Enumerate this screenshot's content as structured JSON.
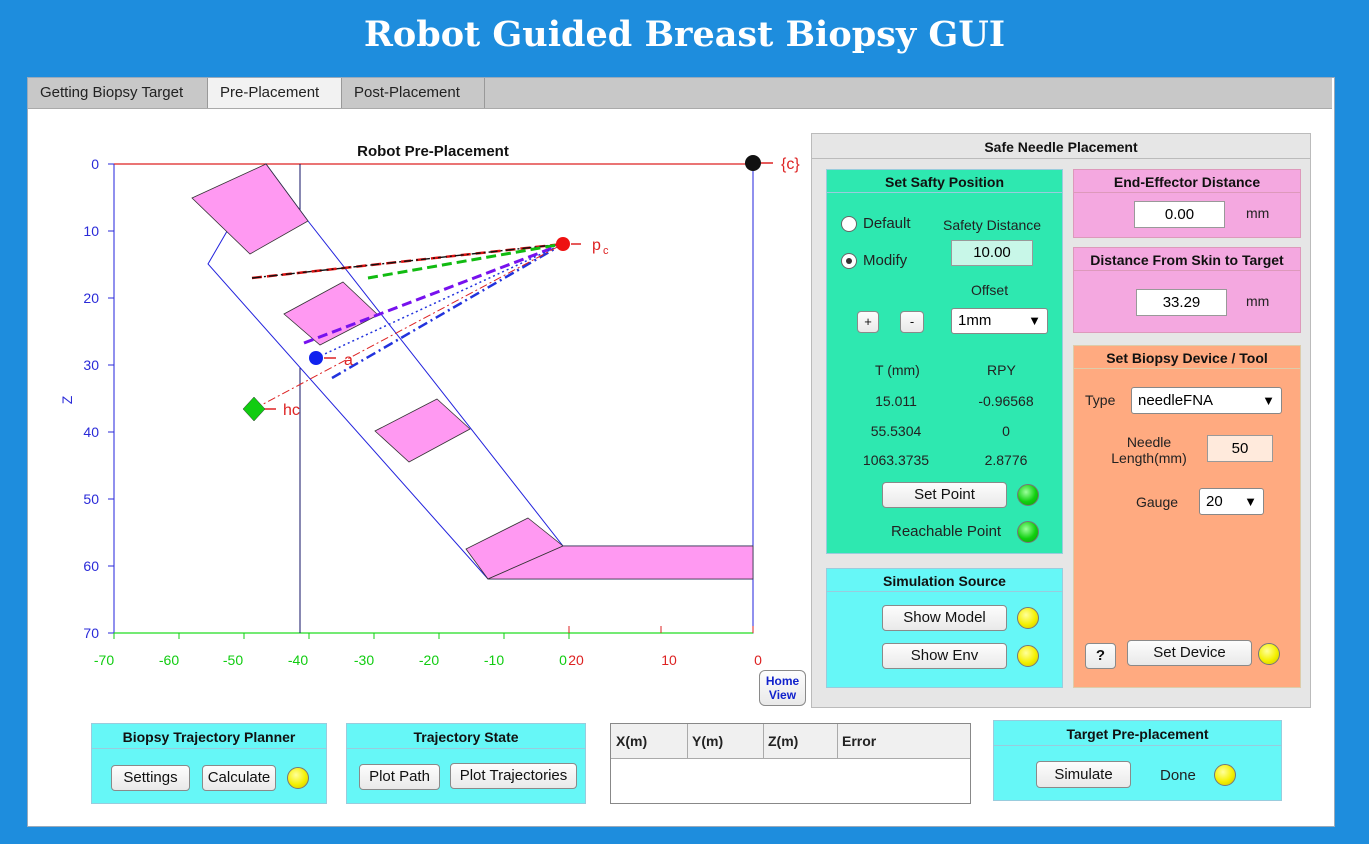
{
  "app": {
    "title": "Robot Guided Breast Biopsy GUI"
  },
  "tabs": [
    {
      "label": "Getting Biopsy Target",
      "active": false
    },
    {
      "label": "Pre-Placement",
      "active": true
    },
    {
      "label": "Post-Placement",
      "active": false
    }
  ],
  "plot": {
    "title": "Robot Pre-Placement",
    "zlabel": "Z",
    "z_ticks": [
      "0",
      "10",
      "20",
      "30",
      "40",
      "50",
      "60",
      "70"
    ],
    "x_ticks_green": [
      "-70",
      "-60",
      "-50",
      "-40",
      "-30",
      "-20",
      "-10",
      "0"
    ],
    "x_ticks_red": [
      "20",
      "10",
      "0"
    ],
    "labels": {
      "c": "{c}",
      "pc": "p",
      "pc_sub": "c",
      "a": "a",
      "hc": "hc"
    },
    "home_view": {
      "line1": "Home",
      "line2": "View"
    }
  },
  "safe_placement": {
    "title": "Safe Needle Placement",
    "safety": {
      "title": "Set Safty Position",
      "default_label": "Default",
      "modify_label": "Modify",
      "selected": "Modify",
      "safety_distance_label": "Safety Distance",
      "safety_distance": "10.00",
      "offset_label": "Offset",
      "offset_value": "1mm",
      "plus": "+",
      "minus": "-",
      "t_header": "T (mm)",
      "rpy_header": "RPY",
      "t_values": [
        "15.011",
        "55.5304",
        "1063.3735"
      ],
      "rpy_values": [
        "-0.96568",
        "0",
        "2.8776"
      ],
      "set_point": "Set Point",
      "reachable": "Reachable Point"
    },
    "end_effector": {
      "title": "End-Effector Distance",
      "value": "0.00",
      "unit": "mm"
    },
    "skin_target": {
      "title": "Distance From Skin to Target",
      "value": "33.29",
      "unit": "mm"
    },
    "device": {
      "title": "Set Biopsy Device / Tool",
      "type_label": "Type",
      "type_value": "needleFNA",
      "needle_length_label_1": "Needle",
      "needle_length_label_2": "Length(mm)",
      "needle_length": "50",
      "gauge_label": "Gauge",
      "gauge_value": "20",
      "help": "?",
      "set_device": "Set Device"
    },
    "simulation": {
      "title": "Simulation Source",
      "show_model": "Show  Model",
      "show_env": "Show Env"
    }
  },
  "planner": {
    "title": "Biopsy Trajectory Planner",
    "settings": "Settings",
    "calculate": "Calculate"
  },
  "traj_state": {
    "title": "Trajectory State",
    "plot_path": "Plot Path",
    "plot_trajectories": "Plot Trajectories"
  },
  "table": {
    "headers": [
      "X(m)",
      "Y(m)",
      "Z(m)",
      "Error"
    ]
  },
  "target": {
    "title": "Target Pre-placement",
    "simulate": "Simulate",
    "done": "Done"
  },
  "colors": {
    "background": "#1e8ddd",
    "green_panel": "#2ee8b0",
    "pink_panel": "#f4a8e0",
    "orange_panel": "#ffaa80",
    "cyan_panel": "#66f7f7",
    "magenta_fill": "#ff99f2"
  }
}
